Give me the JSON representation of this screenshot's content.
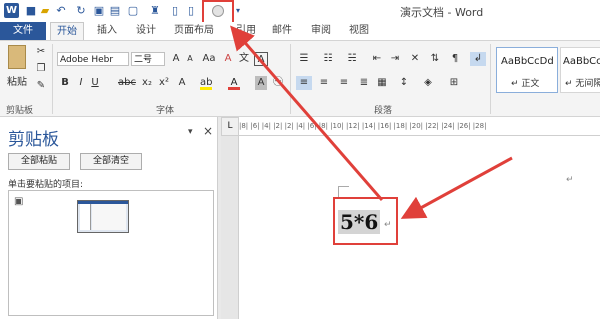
{
  "window": {
    "title": "演示文档 - Word",
    "logo": "W"
  },
  "qat": {
    "icons": [
      "save-icon",
      "folder-open-icon",
      "undo-icon",
      "redo-icon",
      "save-as-icon",
      "print-preview-icon",
      "find-icon",
      "new-doc-icon",
      "circle-icon",
      "customize-icon"
    ]
  },
  "tabs": {
    "file": "文件",
    "home": "开始",
    "insert": "插入",
    "design": "设计",
    "layout": "页面布局",
    "references": "引用",
    "mailings": "邮件",
    "review": "审阅",
    "view": "视图"
  },
  "ribbon": {
    "paste_label": "粘贴",
    "font_name": "Adobe Hebr",
    "font_size": "二号",
    "clipboard_group": "剪贴板",
    "font_group": "字体",
    "paragraph_group": "段落",
    "styles": [
      {
        "preview": "AaBbCcDd",
        "name": "↵ 正文"
      },
      {
        "preview": "AaBbCcDd",
        "name": "↵ 无间隔"
      }
    ]
  },
  "clipboard_pane": {
    "title": "剪贴板",
    "paste_all": "全部粘贴",
    "clear_all": "全部清空",
    "hint": "单击要粘贴的项目:"
  },
  "ruler": {
    "corner": "L",
    "marks": "|8|  |6|  |4|  |2|      |2|  |4|  |6|  |8|  |10|  |12|  |14|  |16|  |18|  |20|  |22|  |24|  |26|  |28|"
  },
  "document": {
    "formula": "5*6",
    "pilcrow": "↵"
  },
  "colors": {
    "accent": "#2b579a",
    "highlight": "#e0403a"
  }
}
